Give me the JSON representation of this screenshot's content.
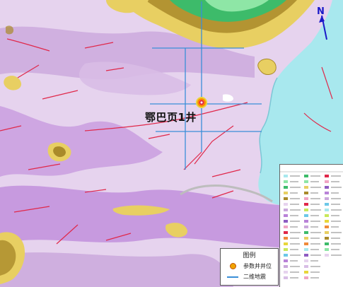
{
  "map": {
    "well_name": "鄂巴页1井",
    "north_label": "N"
  },
  "legend": {
    "title": "图例",
    "items": [
      {
        "symbol": "well-symbol",
        "label": "参数井井位"
      },
      {
        "symbol": "seismic-line",
        "label": "二维地震"
      }
    ]
  },
  "colors": {
    "lavender": "#e6d3ee",
    "violet": "#b982d8",
    "plateau": "#caa8dc",
    "yellow": "#e8cf62",
    "olive": "#a98a2a",
    "green": "#3dbb6a",
    "cyan": "#a8e8ee",
    "fault": "#e0284a",
    "seismic": "#3a8ed8"
  }
}
